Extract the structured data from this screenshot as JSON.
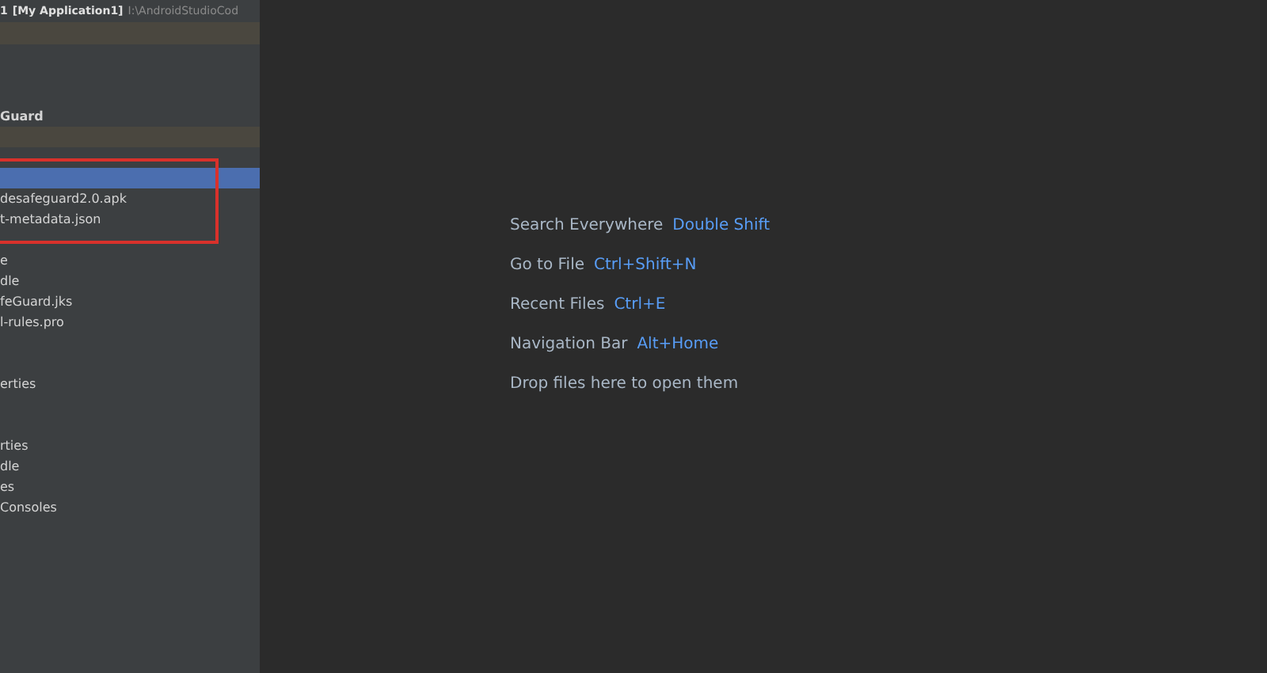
{
  "title_bar": {
    "prefix": "1",
    "project": "[My Application1]",
    "path": "I:\\AndroidStudioCod"
  },
  "project_tree": [
    {
      "label": "Guard",
      "bold": true,
      "selected": false
    },
    {
      "selected": true
    },
    {
      "label": "desafeguard2.0.apk",
      "bold": false,
      "selected": false
    },
    {
      "label": "t-metadata.json",
      "bold": false,
      "selected": false
    },
    {
      "label": "e",
      "bold": false,
      "selected": false
    },
    {
      "label": "dle",
      "bold": false,
      "selected": false
    },
    {
      "label": "feGuard.jks",
      "bold": false,
      "selected": false
    },
    {
      "label": "l-rules.pro",
      "bold": false,
      "selected": false
    },
    {
      "label": "erties",
      "bold": false,
      "selected": false
    },
    {
      "label": "rties",
      "bold": false,
      "selected": false
    },
    {
      "label": "dle",
      "bold": false,
      "selected": false
    },
    {
      "label": "es",
      "bold": false,
      "selected": false
    },
    {
      "label": "Consoles",
      "bold": false,
      "selected": false
    }
  ],
  "hints": [
    {
      "text": "Search Everywhere",
      "shortcut": "Double Shift"
    },
    {
      "text": "Go to File",
      "shortcut": "Ctrl+Shift+N"
    },
    {
      "text": "Recent Files",
      "shortcut": "Ctrl+E"
    },
    {
      "text": "Navigation Bar",
      "shortcut": "Alt+Home"
    },
    {
      "text": "Drop files here to open them"
    }
  ]
}
